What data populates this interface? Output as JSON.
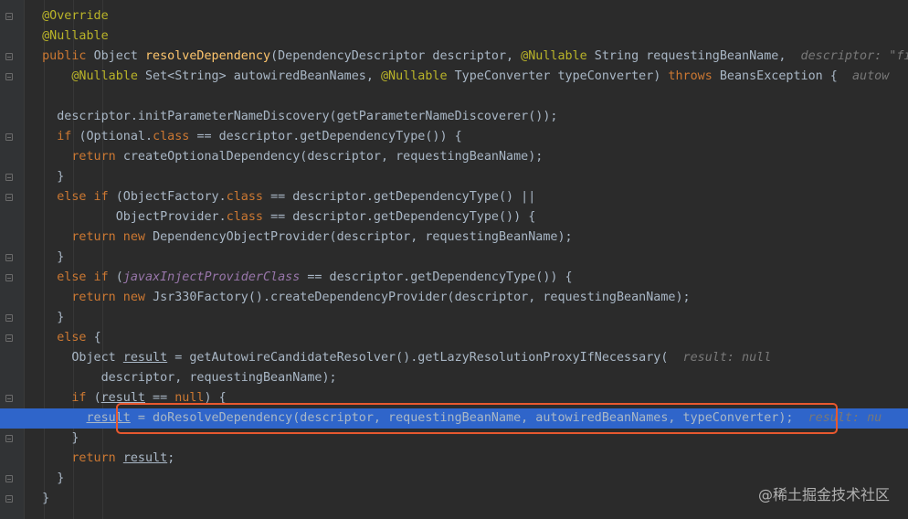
{
  "code_lines": [
    {
      "indent": "  ",
      "tokens": [
        {
          "t": "@Override",
          "c": "ann"
        }
      ]
    },
    {
      "indent": "  ",
      "tokens": [
        {
          "t": "@Nullable",
          "c": "ann"
        }
      ]
    },
    {
      "indent": "  ",
      "tokens": [
        {
          "t": "public ",
          "c": "kw"
        },
        {
          "t": "Object ",
          "c": "pl"
        },
        {
          "t": "resolveDependency",
          "c": "fn"
        },
        {
          "t": "(DependencyDescriptor descriptor, ",
          "c": "pl"
        },
        {
          "t": "@Nullable ",
          "c": "ann"
        },
        {
          "t": "String requestingBeanName,  ",
          "c": "pl"
        },
        {
          "t": "descriptor: \"fie",
          "c": "hint"
        }
      ]
    },
    {
      "indent": "      ",
      "tokens": [
        {
          "t": "@Nullable ",
          "c": "ann"
        },
        {
          "t": "Set<String> autowiredBeanNames, ",
          "c": "pl"
        },
        {
          "t": "@Nullable ",
          "c": "ann"
        },
        {
          "t": "TypeConverter typeConverter) ",
          "c": "pl"
        },
        {
          "t": "throws ",
          "c": "kw"
        },
        {
          "t": "BeansException {  ",
          "c": "pl"
        },
        {
          "t": "autow",
          "c": "hint"
        }
      ]
    },
    {
      "indent": "",
      "tokens": []
    },
    {
      "indent": "    ",
      "tokens": [
        {
          "t": "descriptor.initParameterNameDiscovery(getParameterNameDiscoverer());",
          "c": "pl"
        }
      ]
    },
    {
      "indent": "    ",
      "tokens": [
        {
          "t": "if ",
          "c": "kw"
        },
        {
          "t": "(Optional.",
          "c": "pl"
        },
        {
          "t": "class ",
          "c": "kw"
        },
        {
          "t": "== descriptor.getDependencyType()) {",
          "c": "pl"
        }
      ]
    },
    {
      "indent": "      ",
      "tokens": [
        {
          "t": "return ",
          "c": "kw"
        },
        {
          "t": "createOptionalDependency(descriptor, requestingBeanName);",
          "c": "pl"
        }
      ]
    },
    {
      "indent": "    ",
      "tokens": [
        {
          "t": "}",
          "c": "pl"
        }
      ]
    },
    {
      "indent": "    ",
      "tokens": [
        {
          "t": "else if ",
          "c": "kw"
        },
        {
          "t": "(ObjectFactory.",
          "c": "pl"
        },
        {
          "t": "class ",
          "c": "kw"
        },
        {
          "t": "== descriptor.getDependencyType() ||",
          "c": "pl"
        }
      ]
    },
    {
      "indent": "            ",
      "tokens": [
        {
          "t": "ObjectProvider.",
          "c": "pl"
        },
        {
          "t": "class ",
          "c": "kw"
        },
        {
          "t": "== descriptor.getDependencyType()) {",
          "c": "pl"
        }
      ]
    },
    {
      "indent": "      ",
      "tokens": [
        {
          "t": "return new ",
          "c": "kw"
        },
        {
          "t": "DependencyObjectProvider(descriptor, requestingBeanName);",
          "c": "pl"
        }
      ]
    },
    {
      "indent": "    ",
      "tokens": [
        {
          "t": "}",
          "c": "pl"
        }
      ]
    },
    {
      "indent": "    ",
      "tokens": [
        {
          "t": "else if ",
          "c": "kw"
        },
        {
          "t": "(",
          "c": "pl"
        },
        {
          "t": "javaxInjectProviderClass",
          "c": "field"
        },
        {
          "t": " == descriptor.getDependencyType()) {",
          "c": "pl"
        }
      ]
    },
    {
      "indent": "      ",
      "tokens": [
        {
          "t": "return new ",
          "c": "kw"
        },
        {
          "t": "Jsr330Factory().createDependencyProvider(descriptor, requestingBeanName);",
          "c": "pl"
        }
      ]
    },
    {
      "indent": "    ",
      "tokens": [
        {
          "t": "}",
          "c": "pl"
        }
      ]
    },
    {
      "indent": "    ",
      "tokens": [
        {
          "t": "else ",
          "c": "kw"
        },
        {
          "t": "{",
          "c": "pl"
        }
      ]
    },
    {
      "indent": "      ",
      "tokens": [
        {
          "t": "Object ",
          "c": "pl"
        },
        {
          "t": "result",
          "c": "pl",
          "u": true
        },
        {
          "t": " = getAutowireCandidateResolver().getLazyResolutionProxyIfNecessary(  ",
          "c": "pl"
        },
        {
          "t": "result: null",
          "c": "hint"
        }
      ]
    },
    {
      "indent": "          ",
      "tokens": [
        {
          "t": "descriptor, requestingBeanName);",
          "c": "pl"
        }
      ]
    },
    {
      "indent": "      ",
      "tokens": [
        {
          "t": "if ",
          "c": "kw"
        },
        {
          "t": "(",
          "c": "pl"
        },
        {
          "t": "result",
          "c": "pl",
          "u": true
        },
        {
          "t": " == ",
          "c": "pl"
        },
        {
          "t": "null",
          "c": "kw"
        },
        {
          "t": ") {",
          "c": "pl"
        }
      ]
    },
    {
      "indent": "        ",
      "exec": true,
      "tokens": [
        {
          "t": "result",
          "c": "pl",
          "u": true
        },
        {
          "t": " = doResolveDependency(descriptor, requestingBeanName, autowiredBeanNames, typeConverter);  ",
          "c": "pl"
        },
        {
          "t": "result: nu",
          "c": "hint"
        }
      ]
    },
    {
      "indent": "      ",
      "tokens": [
        {
          "t": "}",
          "c": "pl"
        }
      ]
    },
    {
      "indent": "      ",
      "tokens": [
        {
          "t": "return ",
          "c": "kw"
        },
        {
          "t": "result",
          "c": "pl",
          "u": true
        },
        {
          "t": ";",
          "c": "pl"
        }
      ]
    },
    {
      "indent": "    ",
      "tokens": [
        {
          "t": "}",
          "c": "pl"
        }
      ]
    },
    {
      "indent": "  ",
      "tokens": [
        {
          "t": "}",
          "c": "pl"
        }
      ]
    }
  ],
  "watermark": "@稀土掘金技术社区",
  "colors": {
    "background": "#2b2b2b",
    "gutter": "#313335",
    "execution_line": "#2f65ca",
    "callout_border": "#e8582f",
    "keyword": "#cc7832",
    "annotation": "#bbb529",
    "method": "#ffc66d",
    "plain": "#a9b7c6",
    "hint": "#787878"
  },
  "icons": [
    "fold-marker-icon"
  ]
}
